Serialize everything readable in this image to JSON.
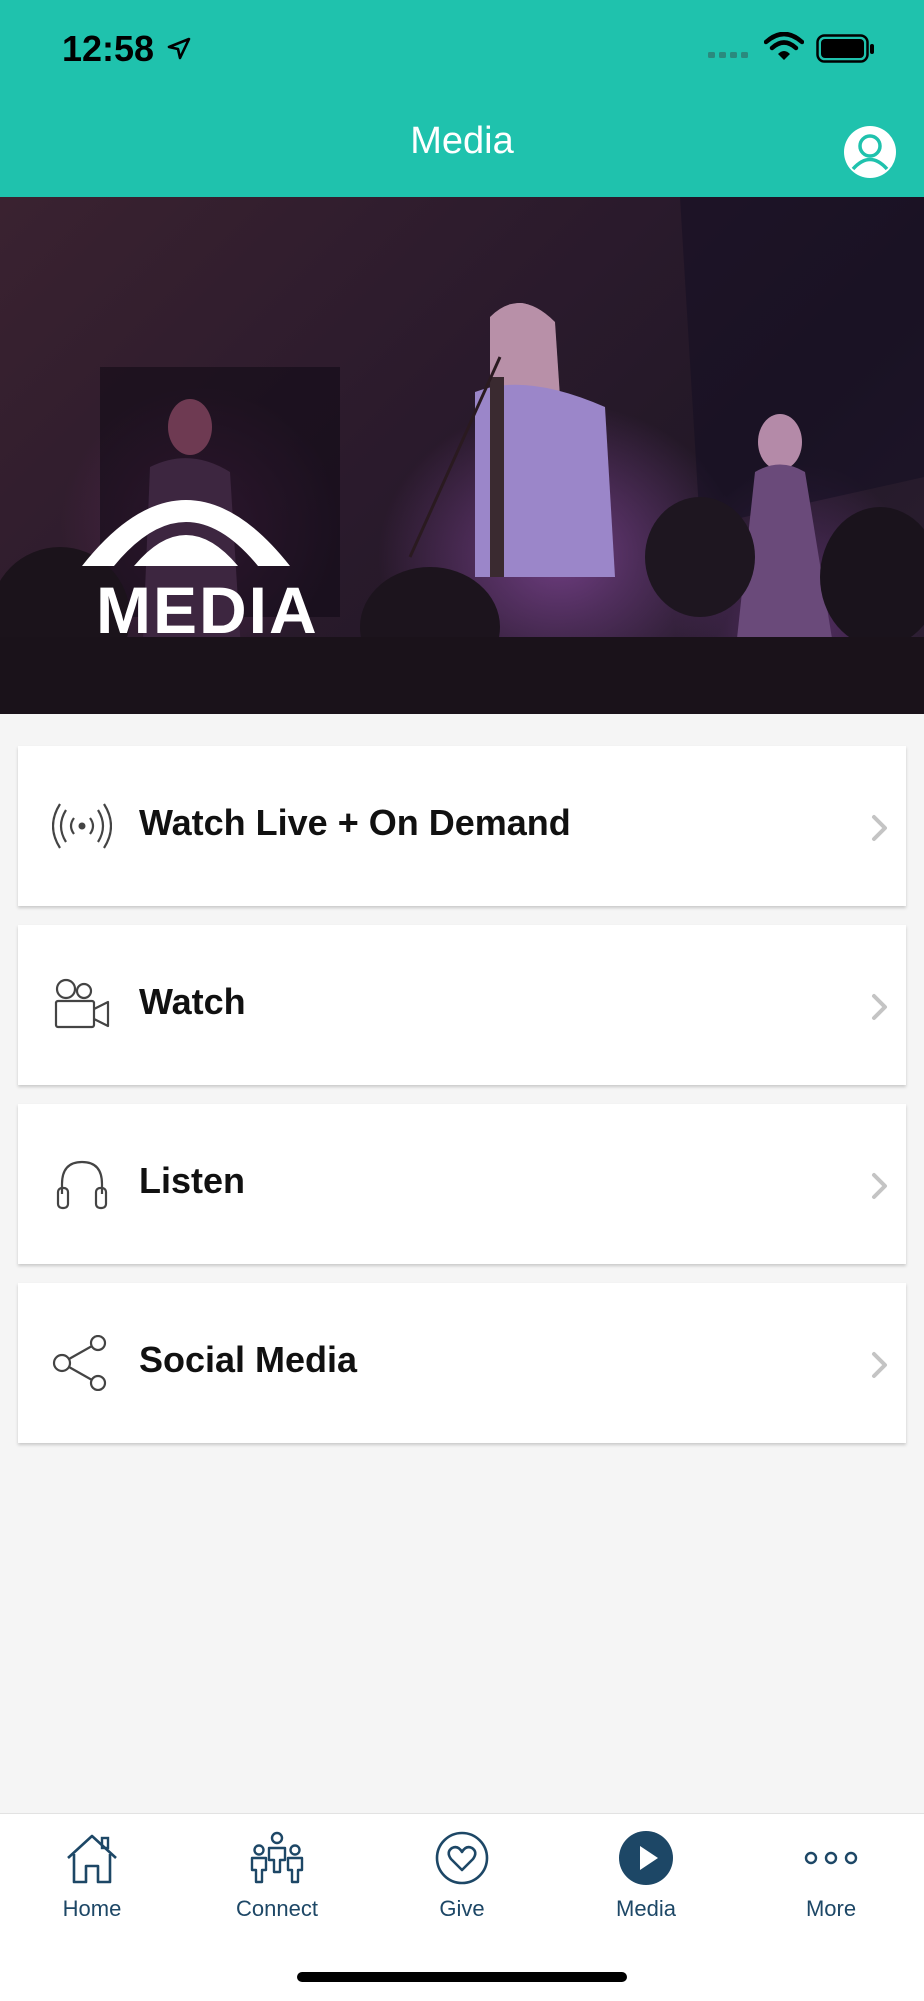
{
  "status_bar": {
    "time": "12:58"
  },
  "header": {
    "title": "Media",
    "background_color": "#1fc2ad"
  },
  "hero": {
    "logo_text": "MEDIA"
  },
  "menu": {
    "items": [
      {
        "label": "Watch Live + On Demand",
        "icon": "broadcast-icon"
      },
      {
        "label": "Watch",
        "icon": "video-camera-icon"
      },
      {
        "label": "Listen",
        "icon": "headphones-icon"
      },
      {
        "label": "Social Media",
        "icon": "share-icon"
      }
    ]
  },
  "tab_bar": {
    "active_color": "#1d4766",
    "tabs": [
      {
        "label": "Home",
        "icon": "home-icon"
      },
      {
        "label": "Connect",
        "icon": "people-icon"
      },
      {
        "label": "Give",
        "icon": "heart-icon"
      },
      {
        "label": "Media",
        "icon": "play-icon",
        "active": true
      },
      {
        "label": "More",
        "icon": "more-icon"
      }
    ]
  }
}
